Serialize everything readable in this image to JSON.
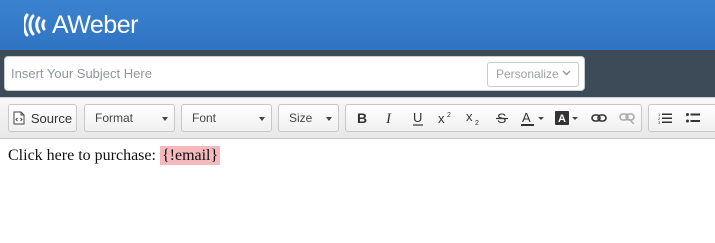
{
  "header": {
    "logo_text": "AWeber"
  },
  "subject": {
    "placeholder": "Insert Your Subject Here",
    "value": "",
    "personalize_label": "Personalize"
  },
  "toolbar": {
    "source_label": "Source",
    "format_label": "Format",
    "font_label": "Font",
    "size_label": "Size"
  },
  "editor": {
    "text": "Click here to purchase: ",
    "merge_tag": "{!email}"
  },
  "colors": {
    "header": "#3a82cf",
    "subject_bar": "#3d4a57",
    "merge_tag_bg": "#f3b9bd"
  }
}
